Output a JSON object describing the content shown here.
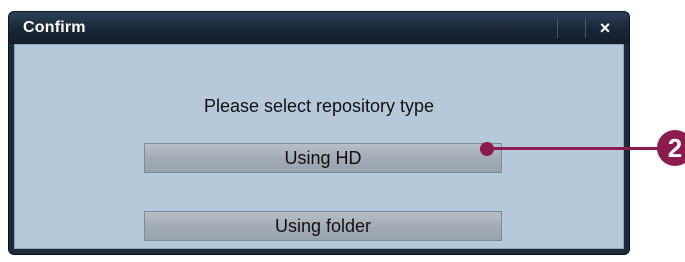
{
  "dialog": {
    "title": "Confirm",
    "close_label": "×",
    "message": "Please select repository type",
    "buttons": {
      "hd": "Using HD",
      "folder": "Using folder"
    }
  },
  "callout": {
    "number": "2",
    "color": "#8b1a4f"
  }
}
